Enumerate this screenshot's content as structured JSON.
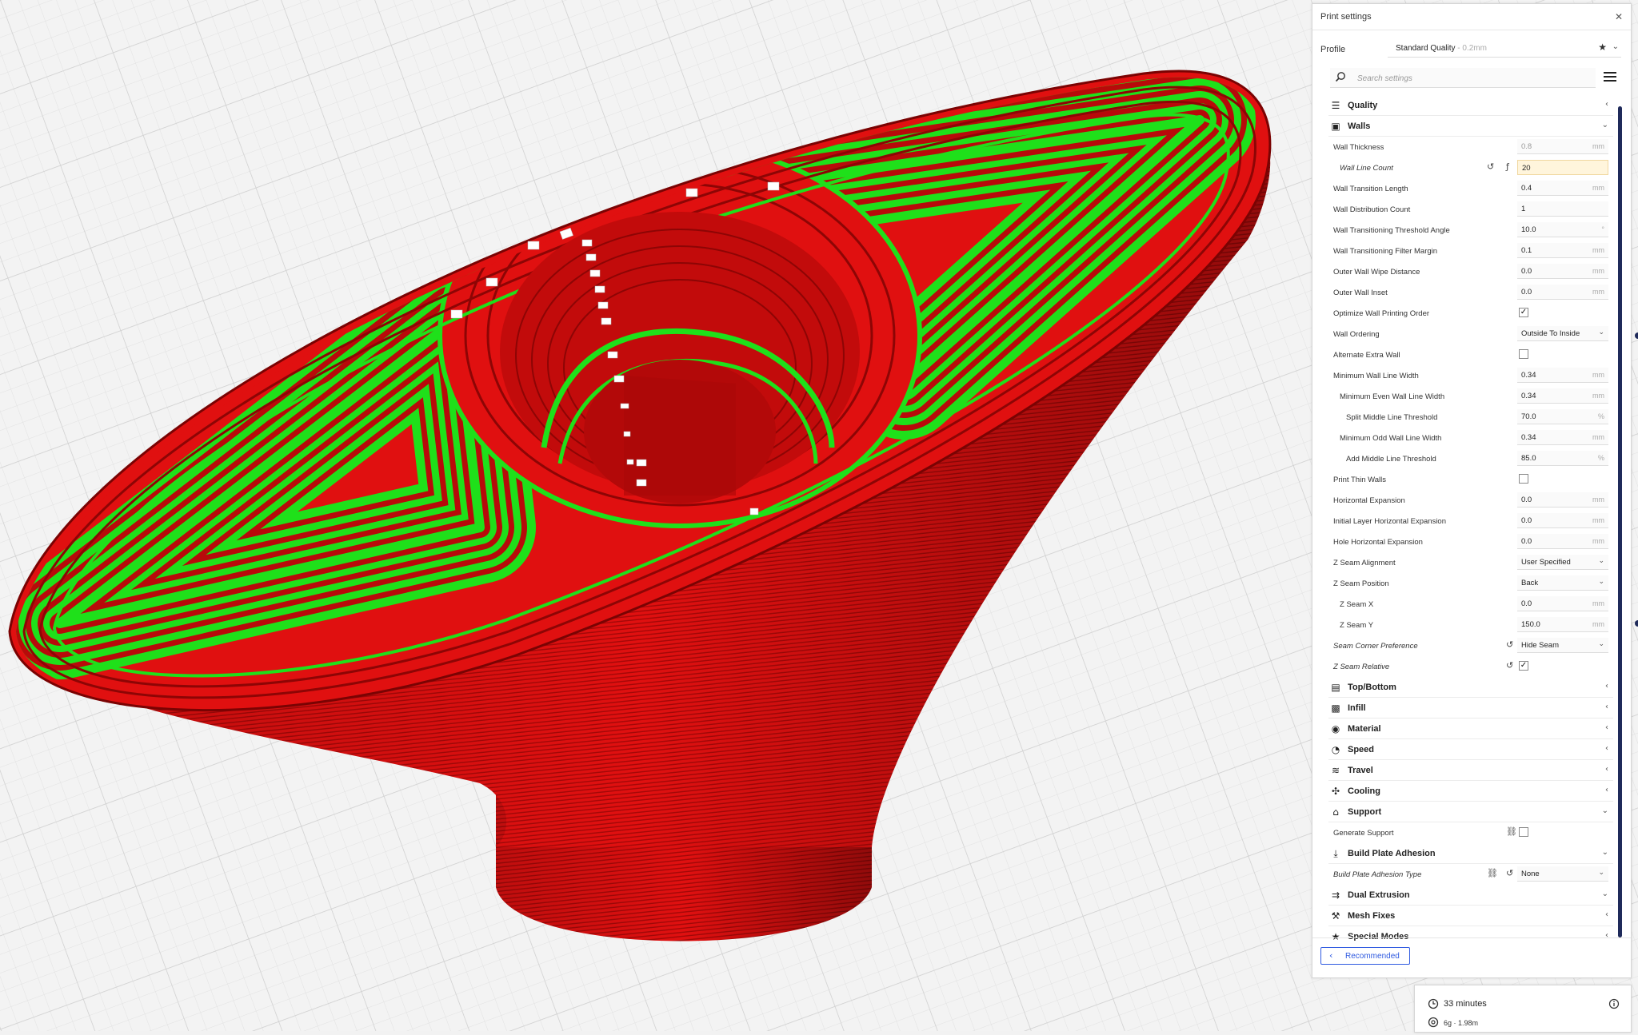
{
  "panel": {
    "title": "Print settings",
    "profile_label": "Profile",
    "profile_name": "Standard Quality",
    "profile_layer": " - 0.2mm",
    "search_placeholder": "Search settings",
    "recommended_label": "Recommended"
  },
  "settings": [
    {
      "kind": "section",
      "label": "Quality",
      "icon": "quality-icon",
      "glyph": "☰",
      "expanded": false
    },
    {
      "kind": "section",
      "label": "Walls",
      "icon": "walls-icon",
      "glyph": "▣",
      "expanded": true
    },
    {
      "kind": "input",
      "label": "Wall Thickness",
      "value": "0.8",
      "unit": "mm",
      "indent": 0,
      "dim": true
    },
    {
      "kind": "input",
      "label": "Wall Line Count",
      "value": "20",
      "unit": "",
      "indent": 1,
      "italic": true,
      "highlight": true,
      "reset": true,
      "fx": true
    },
    {
      "kind": "input",
      "label": "Wall Transition Length",
      "value": "0.4",
      "unit": "mm",
      "indent": 0
    },
    {
      "kind": "input",
      "label": "Wall Distribution Count",
      "value": "1",
      "unit": "",
      "indent": 0
    },
    {
      "kind": "input",
      "label": "Wall Transitioning Threshold Angle",
      "value": "10.0",
      "unit": "°",
      "indent": 0
    },
    {
      "kind": "input",
      "label": "Wall Transitioning Filter Margin",
      "value": "0.1",
      "unit": "mm",
      "indent": 0
    },
    {
      "kind": "input",
      "label": "Outer Wall Wipe Distance",
      "value": "0.0",
      "unit": "mm",
      "indent": 0
    },
    {
      "kind": "input",
      "label": "Outer Wall Inset",
      "value": "0.0",
      "unit": "mm",
      "indent": 0
    },
    {
      "kind": "check",
      "label": "Optimize Wall Printing Order",
      "checked": true,
      "indent": 0
    },
    {
      "kind": "select",
      "label": "Wall Ordering",
      "value": "Outside To Inside",
      "indent": 0
    },
    {
      "kind": "check",
      "label": "Alternate Extra Wall",
      "checked": false,
      "indent": 0
    },
    {
      "kind": "input",
      "label": "Minimum Wall Line Width",
      "value": "0.34",
      "unit": "mm",
      "indent": 0
    },
    {
      "kind": "input",
      "label": "Minimum Even Wall Line Width",
      "value": "0.34",
      "unit": "mm",
      "indent": 1
    },
    {
      "kind": "input",
      "label": "Split Middle Line Threshold",
      "value": "70.0",
      "unit": "%",
      "indent": 2
    },
    {
      "kind": "input",
      "label": "Minimum Odd Wall Line Width",
      "value": "0.34",
      "unit": "mm",
      "indent": 1
    },
    {
      "kind": "input",
      "label": "Add Middle Line Threshold",
      "value": "85.0",
      "unit": "%",
      "indent": 2
    },
    {
      "kind": "check",
      "label": "Print Thin Walls",
      "checked": false,
      "indent": 0
    },
    {
      "kind": "input",
      "label": "Horizontal Expansion",
      "value": "0.0",
      "unit": "mm",
      "indent": 0
    },
    {
      "kind": "input",
      "label": "Initial Layer Horizontal Expansion",
      "value": "0.0",
      "unit": "mm",
      "indent": 0
    },
    {
      "kind": "input",
      "label": "Hole Horizontal Expansion",
      "value": "0.0",
      "unit": "mm",
      "indent": 0
    },
    {
      "kind": "select",
      "label": "Z Seam Alignment",
      "value": "User Specified",
      "indent": 0
    },
    {
      "kind": "select",
      "label": "Z Seam Position",
      "value": "Back",
      "indent": 0
    },
    {
      "kind": "input",
      "label": "Z Seam X",
      "value": "0.0",
      "unit": "mm",
      "indent": 1
    },
    {
      "kind": "input",
      "label": "Z Seam Y",
      "value": "150.0",
      "unit": "mm",
      "indent": 1
    },
    {
      "kind": "select",
      "label": "Seam Corner Preference",
      "value": "Hide Seam",
      "indent": 0,
      "italic": true,
      "reset": true
    },
    {
      "kind": "check",
      "label": "Z Seam Relative",
      "checked": true,
      "indent": 0,
      "italic": true,
      "reset": true
    },
    {
      "kind": "section",
      "label": "Top/Bottom",
      "icon": "top-bottom-icon",
      "glyph": "▤",
      "expanded": false
    },
    {
      "kind": "section",
      "label": "Infill",
      "icon": "infill-icon",
      "glyph": "▩",
      "expanded": false
    },
    {
      "kind": "section",
      "label": "Material",
      "icon": "material-icon",
      "glyph": "◉",
      "expanded": false
    },
    {
      "kind": "section",
      "label": "Speed",
      "icon": "speed-icon",
      "glyph": "◔",
      "expanded": false
    },
    {
      "kind": "section",
      "label": "Travel",
      "icon": "travel-icon",
      "glyph": "≋",
      "expanded": false
    },
    {
      "kind": "section",
      "label": "Cooling",
      "icon": "cooling-icon",
      "glyph": "✣",
      "expanded": false
    },
    {
      "kind": "section",
      "label": "Support",
      "icon": "support-icon",
      "glyph": "⌂",
      "expanded": true
    },
    {
      "kind": "check",
      "label": "Generate Support",
      "checked": false,
      "indent": 0,
      "link": true
    },
    {
      "kind": "section",
      "label": "Build Plate Adhesion",
      "icon": "build-plate-adhesion-icon",
      "glyph": "⤓",
      "expanded": true
    },
    {
      "kind": "select",
      "label": "Build Plate Adhesion Type",
      "value": "None",
      "indent": 0,
      "italic": true,
      "reset": true,
      "link": true
    },
    {
      "kind": "section",
      "label": "Dual Extrusion",
      "icon": "dual-extrusion-icon",
      "glyph": "⇉",
      "expanded": true
    },
    {
      "kind": "section",
      "label": "Mesh Fixes",
      "icon": "mesh-fixes-icon",
      "glyph": "⚒",
      "expanded": false
    },
    {
      "kind": "section",
      "label": "Special Modes",
      "icon": "special-modes-icon",
      "glyph": "★",
      "expanded": false
    }
  ],
  "estimate": {
    "time": "33 minutes",
    "material": "6g · 1.98m"
  },
  "colors": {
    "model_red": "#e01010",
    "model_shadow": "#8d0505",
    "wall_green": "#1fe01a",
    "accent_blue": "#2f5ae0",
    "scrollbar": "#1f2a5a"
  }
}
